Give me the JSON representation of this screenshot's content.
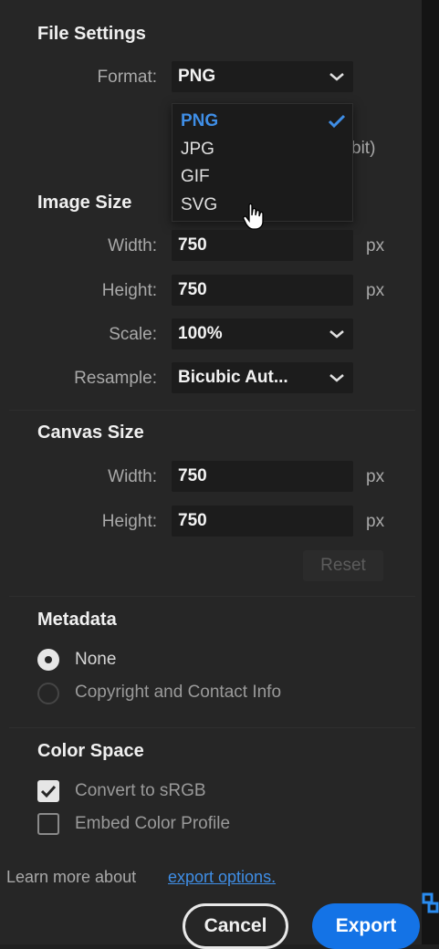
{
  "file_settings": {
    "title": "File Settings",
    "format_label": "Format:",
    "format_value": "PNG",
    "format_options": [
      "PNG",
      "JPG",
      "GIF",
      "SVG"
    ],
    "selected_option": "PNG",
    "hidden_text_fragment": "bit)"
  },
  "image_size": {
    "title": "Image Size",
    "width_label": "Width:",
    "width_value": "750",
    "width_unit": "px",
    "height_label": "Height:",
    "height_value": "750",
    "height_unit": "px",
    "scale_label": "Scale:",
    "scale_value": "100%",
    "resample_label": "Resample:",
    "resample_value": "Bicubic Aut..."
  },
  "canvas_size": {
    "title": "Canvas Size",
    "width_label": "Width:",
    "width_value": "750",
    "width_unit": "px",
    "height_label": "Height:",
    "height_value": "750",
    "height_unit": "px",
    "reset_label": "Reset"
  },
  "metadata": {
    "title": "Metadata",
    "options": [
      {
        "label": "None",
        "selected": true
      },
      {
        "label": "Copyright and Contact Info",
        "selected": false
      }
    ]
  },
  "color_space": {
    "title": "Color Space",
    "options": [
      {
        "label": "Convert to sRGB",
        "checked": true
      },
      {
        "label": "Embed Color Profile",
        "checked": false
      }
    ]
  },
  "footer": {
    "learn_more_text": "Learn more about",
    "learn_more_link": "export options.",
    "cancel_label": "Cancel",
    "export_label": "Export"
  },
  "colors": {
    "accent": "#1473e6",
    "link": "#3f8ee6",
    "panel": "#262626"
  }
}
